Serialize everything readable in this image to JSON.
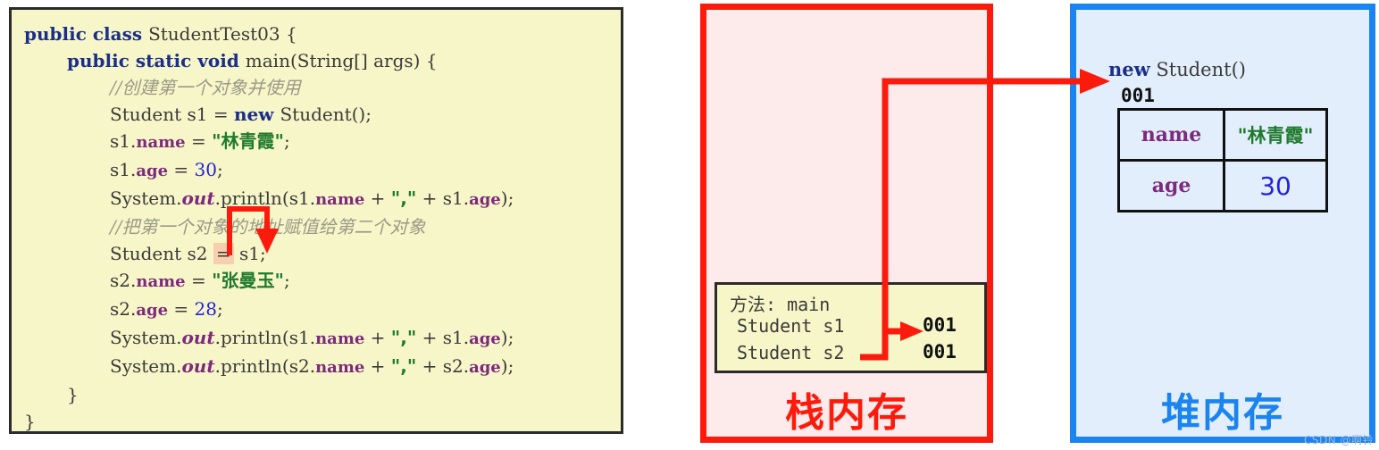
{
  "code_panel": {
    "lines": [
      {
        "indent": 0,
        "parts": [
          {
            "t": "public class ",
            "c": "kw"
          },
          {
            "t": "StudentTest03 {",
            "c": "plain"
          }
        ]
      },
      {
        "indent": 1,
        "parts": [
          {
            "t": "public static void ",
            "c": "kw"
          },
          {
            "t": "main(String[] args) {",
            "c": "plain"
          }
        ]
      },
      {
        "indent": 2,
        "parts": [
          {
            "t": "//创建第一个对象并使用",
            "c": "cmt"
          }
        ]
      },
      {
        "indent": 2,
        "parts": [
          {
            "t": "Student s1 = ",
            "c": "plain"
          },
          {
            "t": "new ",
            "c": "kw"
          },
          {
            "t": "Student();",
            "c": "plain"
          }
        ]
      },
      {
        "indent": 2,
        "parts": [
          {
            "t": "s1.",
            "c": "plain"
          },
          {
            "t": "name",
            "c": "fld"
          },
          {
            "t": " = ",
            "c": "plain"
          },
          {
            "t": "\"林青霞\"",
            "c": "strz"
          },
          {
            "t": ";",
            "c": "plain"
          }
        ]
      },
      {
        "indent": 2,
        "parts": [
          {
            "t": "s1.",
            "c": "plain"
          },
          {
            "t": "age",
            "c": "fld"
          },
          {
            "t": " = ",
            "c": "plain"
          },
          {
            "t": "30",
            "c": "num"
          },
          {
            "t": ";",
            "c": "plain"
          }
        ]
      },
      {
        "indent": 2,
        "parts": [
          {
            "t": "System.",
            "c": "plain"
          },
          {
            "t": "out",
            "c": "outk"
          },
          {
            "t": ".println(s1.",
            "c": "plain"
          },
          {
            "t": "name",
            "c": "fld"
          },
          {
            "t": " + ",
            "c": "plain"
          },
          {
            "t": "\",\"",
            "c": "strz"
          },
          {
            "t": " + s1.",
            "c": "plain"
          },
          {
            "t": "age",
            "c": "fld"
          },
          {
            "t": ");",
            "c": "plain"
          }
        ]
      },
      {
        "indent": 2,
        "parts": [
          {
            "t": "//把第一个对象的地址赋值给第二个对象",
            "c": "cmt"
          }
        ]
      },
      {
        "indent": 2,
        "parts": [
          {
            "t": "Student s2 ",
            "c": "plain"
          },
          {
            "t": "=",
            "c": "hl"
          },
          {
            "t": " s1;",
            "c": "plain"
          }
        ]
      },
      {
        "indent": 2,
        "parts": [
          {
            "t": "s2.",
            "c": "plain"
          },
          {
            "t": "name",
            "c": "fld"
          },
          {
            "t": " = ",
            "c": "plain"
          },
          {
            "t": "\"张曼玉\"",
            "c": "strz"
          },
          {
            "t": ";",
            "c": "plain"
          }
        ]
      },
      {
        "indent": 2,
        "parts": [
          {
            "t": "s2.",
            "c": "plain"
          },
          {
            "t": "age",
            "c": "fld"
          },
          {
            "t": " = ",
            "c": "plain"
          },
          {
            "t": "28",
            "c": "num"
          },
          {
            "t": ";",
            "c": "plain"
          }
        ]
      },
      {
        "indent": 2,
        "parts": [
          {
            "t": "System.",
            "c": "plain"
          },
          {
            "t": "out",
            "c": "outk"
          },
          {
            "t": ".println(s1.",
            "c": "plain"
          },
          {
            "t": "name",
            "c": "fld"
          },
          {
            "t": " + ",
            "c": "plain"
          },
          {
            "t": "\",\"",
            "c": "strz"
          },
          {
            "t": " + s1.",
            "c": "plain"
          },
          {
            "t": "age",
            "c": "fld"
          },
          {
            "t": ");",
            "c": "plain"
          }
        ]
      },
      {
        "indent": 2,
        "parts": [
          {
            "t": "System.",
            "c": "plain"
          },
          {
            "t": "out",
            "c": "outk"
          },
          {
            "t": ".println(s2.",
            "c": "plain"
          },
          {
            "t": "name",
            "c": "fld"
          },
          {
            "t": " + ",
            "c": "plain"
          },
          {
            "t": "\",\"",
            "c": "strz"
          },
          {
            "t": " + s2.",
            "c": "plain"
          },
          {
            "t": "age",
            "c": "fld"
          },
          {
            "t": ");",
            "c": "plain"
          }
        ]
      },
      {
        "indent": 1,
        "parts": [
          {
            "t": "}",
            "c": "plain"
          }
        ]
      },
      {
        "indent": 0,
        "parts": [
          {
            "t": "}",
            "c": "plain"
          }
        ]
      }
    ]
  },
  "stack_panel": {
    "title": "栈内存",
    "method_label": "方法: main",
    "var1": "Student s1",
    "var2": "Student s2",
    "addr1": "001",
    "addr2": "001",
    "border_color": "#fb1b0c",
    "fill_color": "#fdeaea"
  },
  "heap_panel": {
    "title": "堆内存",
    "new_keyword": "new",
    "new_expression": " Student()",
    "address": "001",
    "fields": [
      {
        "key": "name",
        "value": "\"林青霞\"",
        "value_kind": "string"
      },
      {
        "key": "age",
        "value": "30",
        "value_kind": "number"
      }
    ],
    "border_color": "#1a84f0",
    "fill_color": "#e3eefc"
  },
  "annotations": {
    "connector_color": "#fb1b0c",
    "highlight_color": "#f7cfae"
  },
  "watermark": "CSDN @啊铃"
}
